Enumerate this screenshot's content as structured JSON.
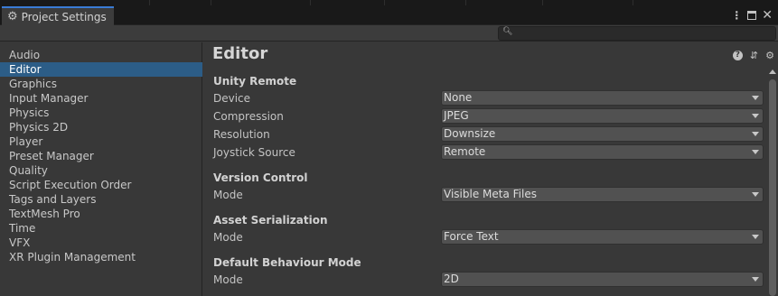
{
  "window": {
    "tab_title": "Project Settings",
    "tab_icon": "gear-icon"
  },
  "search": {
    "value": "",
    "placeholder": ""
  },
  "sidebar": {
    "items": [
      {
        "label": "Audio",
        "active": false
      },
      {
        "label": "Editor",
        "active": true
      },
      {
        "label": "Graphics",
        "active": false
      },
      {
        "label": "Input Manager",
        "active": false
      },
      {
        "label": "Physics",
        "active": false
      },
      {
        "label": "Physics 2D",
        "active": false
      },
      {
        "label": "Player",
        "active": false
      },
      {
        "label": "Preset Manager",
        "active": false
      },
      {
        "label": "Quality",
        "active": false
      },
      {
        "label": "Script Execution Order",
        "active": false
      },
      {
        "label": "Tags and Layers",
        "active": false
      },
      {
        "label": "TextMesh Pro",
        "active": false
      },
      {
        "label": "Time",
        "active": false
      },
      {
        "label": "VFX",
        "active": false
      },
      {
        "label": "XR Plugin Management",
        "active": false
      }
    ]
  },
  "main": {
    "title": "Editor",
    "sections": {
      "unity_remote": {
        "header": "Unity Remote",
        "device": {
          "label": "Device",
          "value": "None"
        },
        "compression": {
          "label": "Compression",
          "value": "JPEG"
        },
        "resolution": {
          "label": "Resolution",
          "value": "Downsize"
        },
        "joystick": {
          "label": "Joystick Source",
          "value": "Remote"
        }
      },
      "version_control": {
        "header": "Version Control",
        "mode": {
          "label": "Mode",
          "value": "Visible Meta Files"
        }
      },
      "asset_serialization": {
        "header": "Asset Serialization",
        "mode": {
          "label": "Mode",
          "value": "Force Text"
        }
      },
      "default_behaviour": {
        "header": "Default Behaviour Mode",
        "mode": {
          "label": "Mode",
          "value": "2D"
        }
      }
    }
  },
  "colors": {
    "selection": "#2c5d87",
    "tab_accent": "#3a7bd5",
    "panel_bg": "#383838"
  }
}
